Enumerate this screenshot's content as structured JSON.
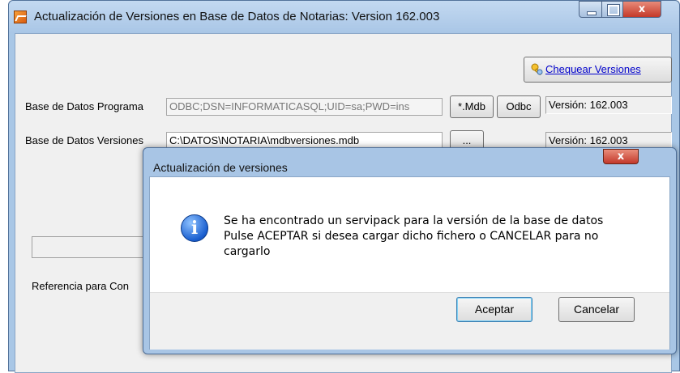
{
  "window": {
    "title": "Actualización de Versiones en Base de Datos de Notarias: Version 162.003",
    "close_glyph": "x"
  },
  "main": {
    "check_button_label": "Chequear Versiones",
    "rows": [
      {
        "label": "Base de Datos Programa",
        "value": "ODBC;DSN=INFORMATICASQL;UID=sa;PWD=ins",
        "buttons": [
          "*.Mdb",
          "Odbc"
        ],
        "version": "Versión: 162.003"
      },
      {
        "label": "Base de Datos Versiones",
        "value": "C:\\DATOS\\NOTARIA\\mdbversiones.mdb",
        "buttons": [
          "..."
        ],
        "version": "Versión: 162.003"
      }
    ],
    "reference_label": "Referencia para Con"
  },
  "dialog": {
    "title": "Actualización de versiones",
    "close_glyph": "x",
    "icon": "info-icon",
    "message_lines": [
      "Se ha encontrado un servipack para la versión de la base de datos",
      "Pulse ACEPTAR si desea cargar dicho fichero o CANCELAR para no",
      "cargarlo"
    ],
    "ok_label": "Aceptar",
    "cancel_label": "Cancelar"
  }
}
